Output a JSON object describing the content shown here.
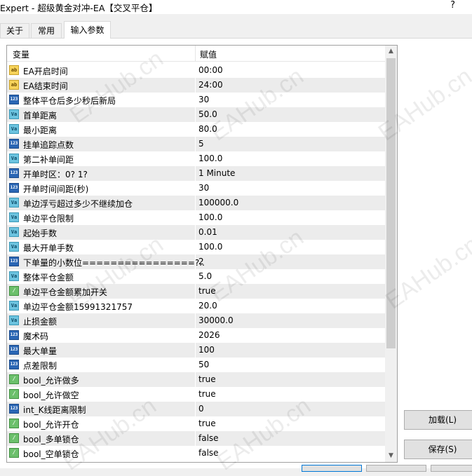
{
  "window": {
    "title": "Expert - 超级黄金对冲-EA【交叉平仓】",
    "help": "?"
  },
  "tabs": [
    {
      "label": "关于",
      "active": false
    },
    {
      "label": "常用",
      "active": false
    },
    {
      "label": "输入参数",
      "active": true
    }
  ],
  "grid": {
    "col_variable": "变量",
    "col_value": "赋值",
    "rows": [
      {
        "type": "ab",
        "name": "EA开启时间",
        "value": "00:00"
      },
      {
        "type": "ab",
        "name": "EA结束时间",
        "value": "24:00"
      },
      {
        "type": "n123",
        "name": "整体平仓后多少秒后新局",
        "value": "30"
      },
      {
        "type": "va",
        "name": "首单距离",
        "value": "50.0"
      },
      {
        "type": "va",
        "name": "最小距离",
        "value": "80.0"
      },
      {
        "type": "n123",
        "name": "挂单追踪点数",
        "value": "5"
      },
      {
        "type": "va",
        "name": "第二补单间距",
        "value": "100.0"
      },
      {
        "type": "n123",
        "name": "开单时区：0? 1?",
        "value": "1 Minute"
      },
      {
        "type": "n123",
        "name": "开单时间间距(秒)",
        "value": "30"
      },
      {
        "type": "va",
        "name": "单边浮亏超过多少不继续加仓",
        "value": "100000.0"
      },
      {
        "type": "va",
        "name": "单边平仓限制",
        "value": "100.0"
      },
      {
        "type": "va",
        "name": "起始手数",
        "value": "0.01"
      },
      {
        "type": "va",
        "name": "最大开单手数",
        "value": "100.0"
      },
      {
        "type": "n123",
        "name": "下单量的小数位================?..",
        "value": "2"
      },
      {
        "type": "va",
        "name": "整体平仓金额",
        "value": "5.0"
      },
      {
        "type": "bool",
        "name": "单边平仓金额累加开关",
        "value": "true"
      },
      {
        "type": "va",
        "name": "单边平仓金额15991321757",
        "value": "20.0"
      },
      {
        "type": "va",
        "name": "止损金额",
        "value": "30000.0"
      },
      {
        "type": "n123",
        "name": "魔术码",
        "value": "2026"
      },
      {
        "type": "n123",
        "name": "最大单量",
        "value": "100"
      },
      {
        "type": "n123",
        "name": "点差限制",
        "value": "50"
      },
      {
        "type": "bool",
        "name": "bool_允许做多",
        "value": "true"
      },
      {
        "type": "bool",
        "name": "bool_允许做空",
        "value": "true"
      },
      {
        "type": "n123",
        "name": "int_K线距离限制",
        "value": "0"
      },
      {
        "type": "bool",
        "name": "bool_允许开仓",
        "value": "true"
      },
      {
        "type": "bool",
        "name": "bool_多单锁仓",
        "value": "false"
      },
      {
        "type": "bool",
        "name": "bool_空单锁仓",
        "value": "false"
      }
    ]
  },
  "icons": {
    "ab": "ab",
    "n123": "123",
    "va": "Va",
    "bool": "⁄"
  },
  "buttons": {
    "load": "加载(L)",
    "save": "保存(S)"
  },
  "watermark": "EAHub.cn",
  "colors": {
    "row_alt": "#ececec",
    "button_face": "#e1e1e1",
    "focus_border": "#0078d7"
  }
}
